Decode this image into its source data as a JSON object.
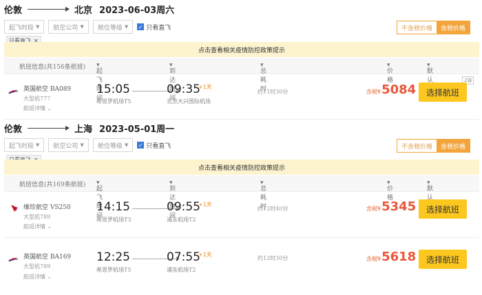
{
  "sections": [
    {
      "from": "伦敦",
      "to": "北京",
      "date": "2023-06-03周六",
      "filters": [
        "起飞时段",
        "航空公司",
        "舱位等级"
      ],
      "direct_only_label": "只看直飞",
      "tax_toggle": {
        "off": "不含税价格",
        "on": "含税价格"
      },
      "chip_label": "只看直飞",
      "notice": "点击查看相关疫情防控政策提示",
      "headers": {
        "info": "航班信息(共156条航班)",
        "dep": "起飞时间",
        "arr": "到达时间",
        "dur": "总耗时",
        "price": "价格",
        "sort": "默认排序"
      },
      "flights": [
        {
          "airline": "英国航空 BA089",
          "plane": "大型机777",
          "detail": "航班详情",
          "dep_time": "15:05",
          "dep_airport": "希思罗机场T5",
          "arr_time": "09:35",
          "plus_day": "+1天",
          "arr_airport": "北京大兴国际机场",
          "duration": "约11时30分",
          "price_label": "含税¥",
          "price": "5084",
          "seats": "2张",
          "select": "选择航班",
          "logo": "ba-logo-icon"
        }
      ]
    },
    {
      "from": "伦敦",
      "to": "上海",
      "date": "2023-05-01周一",
      "filters": [
        "起飞时段",
        "航空公司",
        "舱位等级"
      ],
      "direct_only_label": "只看直飞",
      "tax_toggle": {
        "off": "不含税价格",
        "on": "含税价格"
      },
      "chip_label": "只看直飞",
      "notice": "点击查看相关疫情防控政策提示",
      "headers": {
        "info": "航班信息(共169条航班)",
        "dep": "起飞时间",
        "arr": "到达时间",
        "dur": "总耗时",
        "price": "价格",
        "sort": "默认排序"
      },
      "flights": [
        {
          "airline": "维珍航空 VS250",
          "plane": "大型机789",
          "detail": "航班详情",
          "dep_time": "14:15",
          "dep_airport": "希思罗机场T3",
          "arr_time": "09:55",
          "plus_day": "+1天",
          "arr_airport": "浦东机场T2",
          "duration": "约12时40分",
          "price_label": "含税¥",
          "price": "5345",
          "select": "选择航班",
          "logo": "virgin-logo-icon"
        },
        {
          "airline": "英国航空 BA169",
          "plane": "大型机789",
          "detail": "航班详情",
          "dep_time": "12:25",
          "dep_airport": "希思罗机场T5",
          "arr_time": "07:55",
          "plus_day": "+1天",
          "arr_airport": "浦东机场T2",
          "duration": "约12时30分",
          "price_label": "含税¥",
          "price": "5618",
          "select": "选择航班",
          "logo": "ba-logo-icon"
        }
      ]
    }
  ],
  "colors": {
    "accent": "#fcc71f",
    "price": "#e9563a",
    "notice_bg": "#fdf3cf",
    "tax_on": "#f3a43a"
  }
}
